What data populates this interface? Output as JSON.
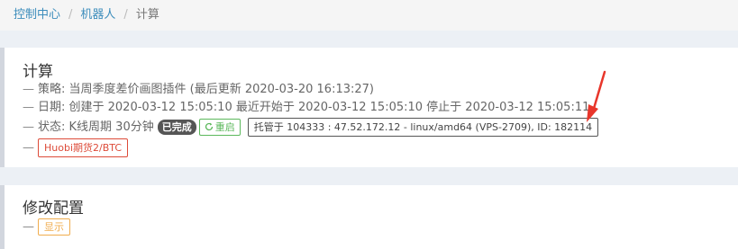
{
  "breadcrumb": {
    "home": "控制中心",
    "robots": "机器人",
    "current": "计算"
  },
  "robot": {
    "title": "计算",
    "dash": "—",
    "strategy_text": "策略: 当周季度差价画图插件 (最后更新 2020-03-20 16:13:27)",
    "date_text": "日期: 创建于 2020-03-12 15:05:10 最近开始于 2020-03-12 15:05:10 停止于 2020-03-12 15:05:11",
    "status_text": "状态: K线周期 30分钟",
    "status_badge": "已完成",
    "restart_icon": "refresh-icon",
    "restart_label": "重启",
    "host_text": "托管于 104333 : 47.52.172.12 - linux/amd64 (VPS-2709), ID: 182114",
    "exchange_tag": "Huobi期货2/BTC"
  },
  "config": {
    "title": "修改配置",
    "dash": "—",
    "show_button": "显示"
  },
  "colors": {
    "link": "#3c8dbc",
    "success": "#5cb85c",
    "danger": "#dd4b39",
    "warning": "#f0ad4e",
    "annotation_arrow": "#e8362b"
  }
}
